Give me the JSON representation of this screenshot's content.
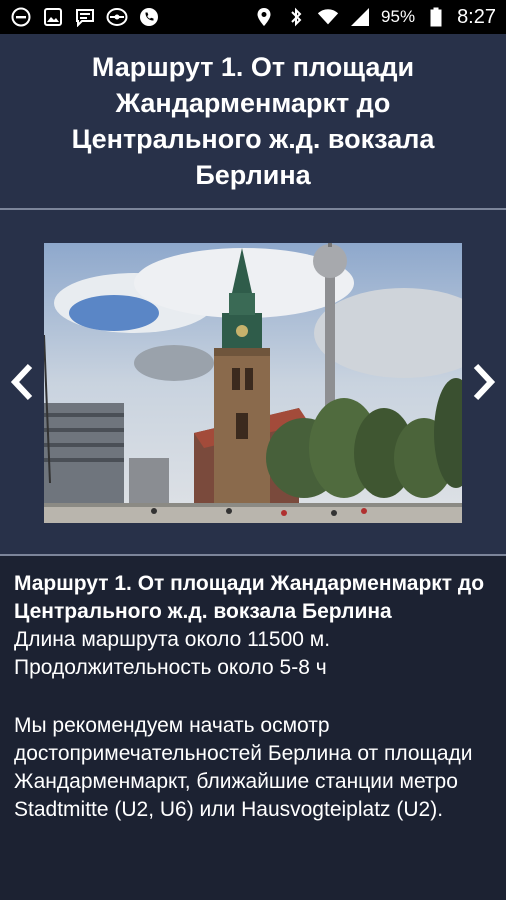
{
  "status_bar": {
    "battery": "95%",
    "time": "8:27",
    "left_icons": [
      "minus-circle-icon",
      "image-icon",
      "message-icon",
      "pilot-icon",
      "phone-icon"
    ],
    "right_icons": [
      "location-icon",
      "bluetooth-icon",
      "wifi-icon",
      "signal-icon",
      "battery-icon"
    ]
  },
  "header": {
    "title": "Маршрут 1. От площади Жандарменмаркт до Центрального ж.д. вокзала Берлина"
  },
  "gallery": {
    "prev_icon": "chevron-left-icon",
    "next_icon": "chevron-right-icon"
  },
  "content": {
    "title": "Маршрут 1. От площади Жандарменмаркт до Центрального ж.д. вокзала Берлина",
    "length": "Длина маршрута около 11500 м.",
    "duration": "Продолжительность около 5-8 ч",
    "paragraph": "Мы рекомендуем начать осмотр достопримечательностей Берлина от площади Жандарменмаркт, ближайшие станции метро Stadtmitte (U2, U6) или Hausvogteiplatz (U2)."
  },
  "colors": {
    "header_bg": "#283149",
    "page_bg": "#1c2232",
    "divider": "#7c859a"
  }
}
